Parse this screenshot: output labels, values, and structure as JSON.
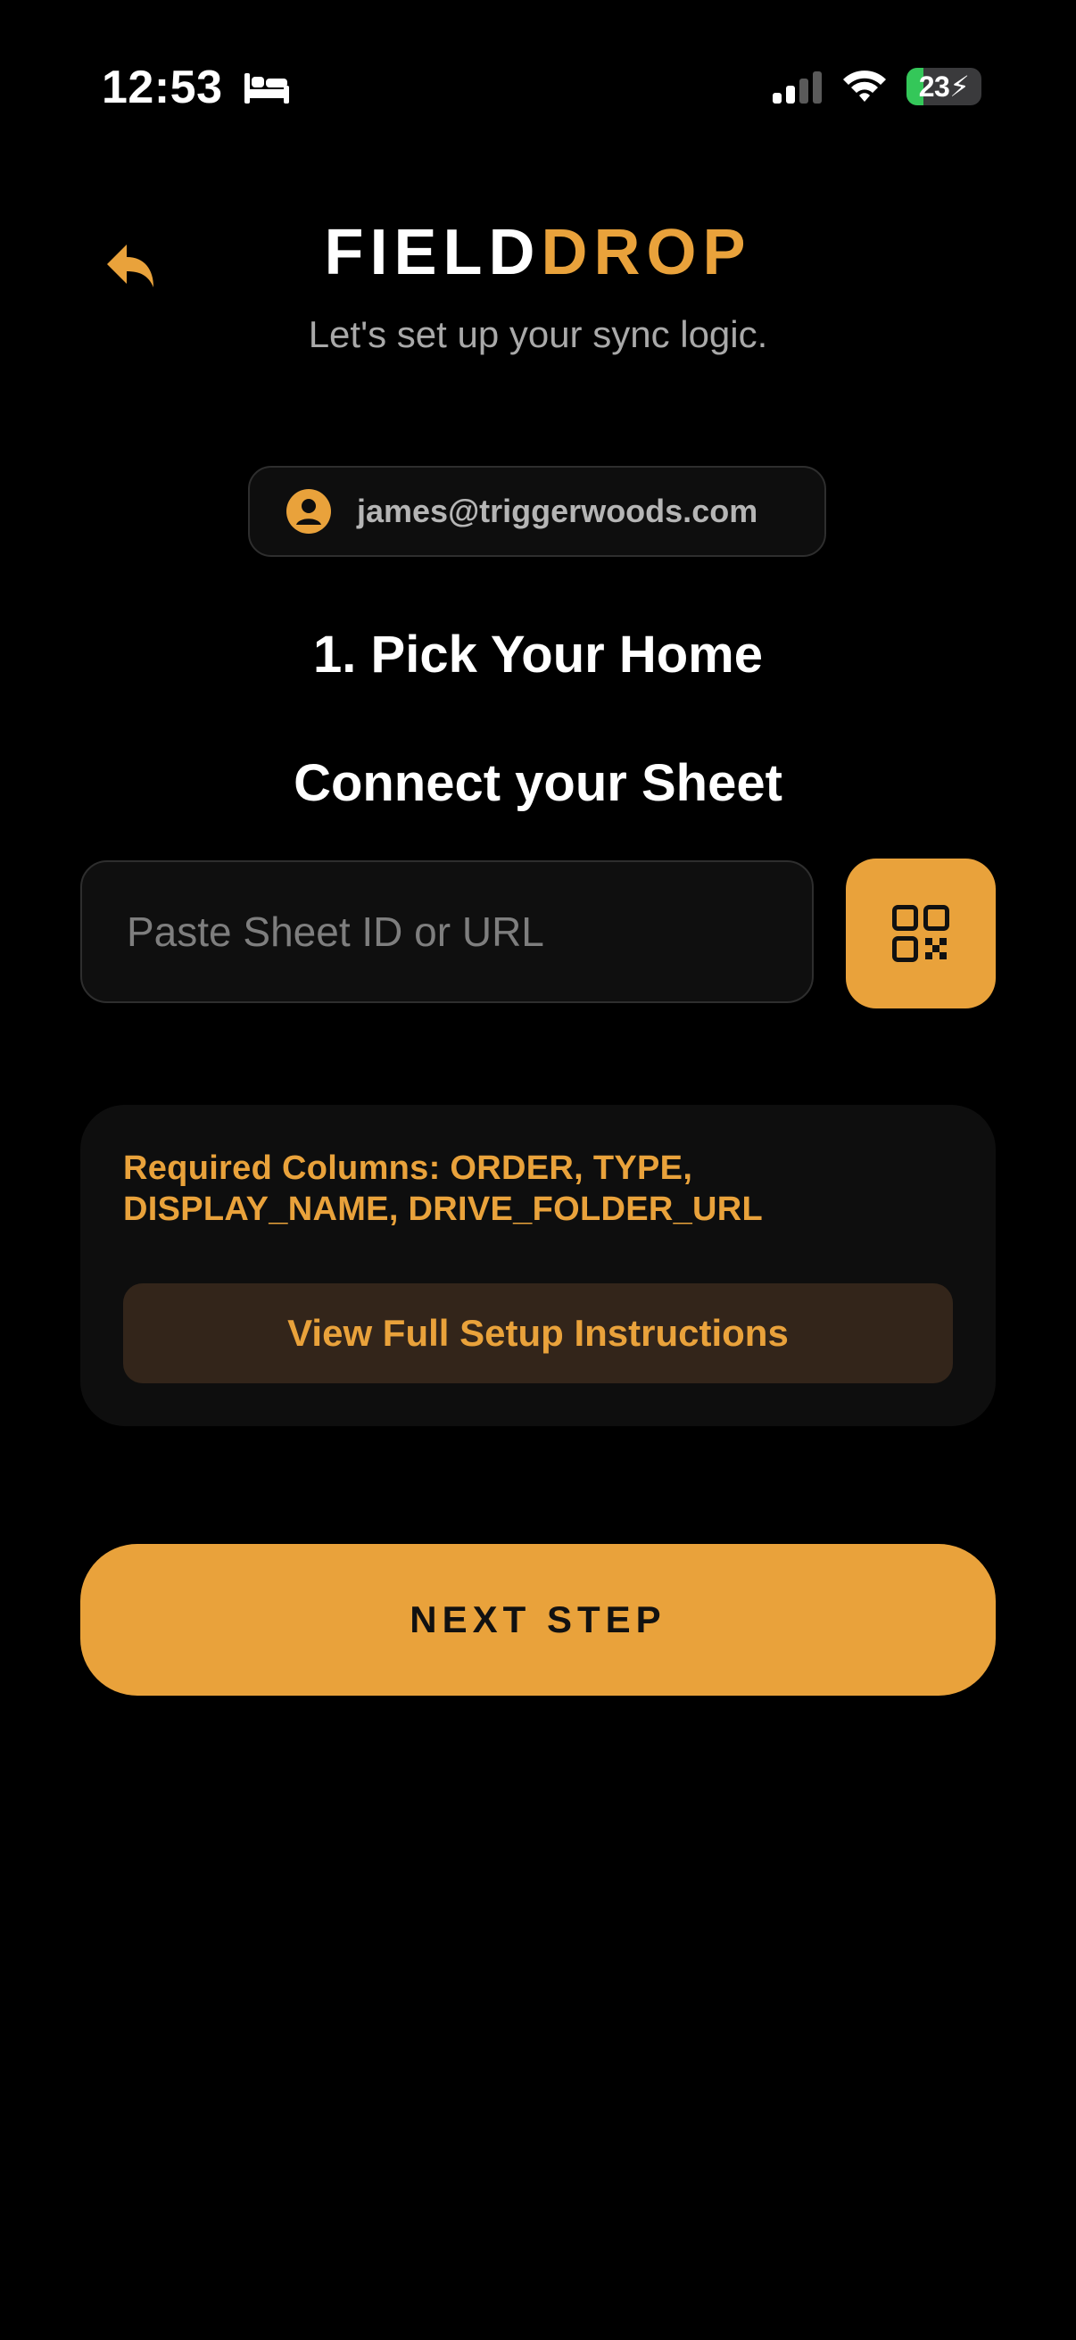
{
  "status_bar": {
    "time": "12:53",
    "battery_level": "23",
    "battery_fraction": 0.23,
    "signal_bars": 2,
    "icons": [
      "bed-icon",
      "cellular-signal-icon",
      "wifi-icon",
      "battery-charging-icon"
    ]
  },
  "header": {
    "brand_part1": "FIELD",
    "brand_part2": "DROP",
    "subtitle": "Let's set up your sync logic.",
    "back_icon": "reply-arrow-icon"
  },
  "account": {
    "email": "james@triggerwoods.com",
    "icon": "user-circle-icon"
  },
  "step": {
    "title": "1. Pick Your Home",
    "subtitle": "Connect your Sheet"
  },
  "sheet_input": {
    "placeholder": "Paste Sheet ID or URL",
    "value": ""
  },
  "qr_button": {
    "icon": "qr-code-icon"
  },
  "info_card": {
    "required_columns_text": "Required Columns: ORDER, TYPE, DISPLAY_NAME, DRIVE_FOLDER_URL",
    "instructions_label": "View Full Setup Instructions"
  },
  "next_button": {
    "label": "NEXT STEP"
  },
  "colors": {
    "background": "#000000",
    "accent": "#e9a23b",
    "card": "#0e0e0e",
    "muted_text": "#a9a9a9",
    "instructions_bg": "#33251a",
    "battery_green": "#34c759"
  }
}
